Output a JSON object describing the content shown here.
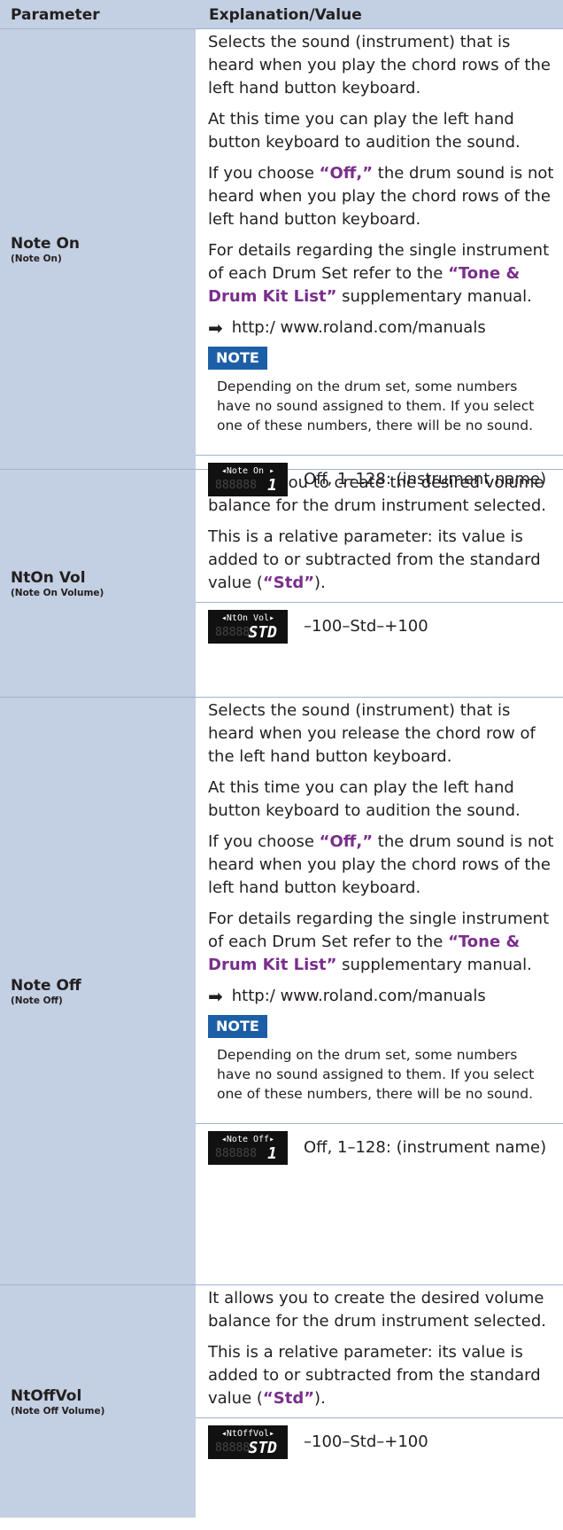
{
  "header": {
    "col1": "Parameter",
    "col2": "Explanation/Value"
  },
  "rows": [
    {
      "name": "Note On",
      "sub": "(Note On)",
      "p1": "Selects the sound (instrument) that is heard when you play the chord rows of the left hand button keyboard.",
      "p2": "At this time you can play the left hand button keyboard to audition the sound.",
      "p3a": "If you choose ",
      "p3q": "“Off,”",
      "p3b": " the drum sound is not heard when you play the chord rows of the left hand button keyboard.",
      "p4a": "For details regarding the single instrument of each Drum Set refer to the ",
      "p4q": "“Tone & Drum Kit List”",
      "p4b": " supplementary manual.",
      "link": "http:/ www.roland.com/manuals",
      "note_label": "NOTE",
      "note": "Depending on the drum set, some numbers have no sound assigned to them. If you select one of these numbers, there will be no sound.",
      "lcd_top": "◂Note On ▸",
      "lcd_val": "1",
      "value": "Off, 1–128: (instrument name)"
    },
    {
      "name": "NtOn Vol",
      "sub": "(Note On Volume)",
      "p1": "It allows you to create the desired volume balance for the drum instrument selected.",
      "p2a": "This is a relative parameter: its value is added to or subtracted from the standard value (",
      "p2q": "“Std”",
      "p2b": ").",
      "lcd_top": "◂NtOn Vol▸",
      "lcd_val": "STD",
      "value": "–100–Std–+100"
    },
    {
      "name": "Note Off",
      "sub": "(Note Off)",
      "p1": "Selects the sound (instrument) that is heard when you release the chord row of the left hand button keyboard.",
      "p2": "At this time you can play the left hand button keyboard to audition the sound.",
      "p3a": "If you choose ",
      "p3q": "“Off,”",
      "p3b": " the drum sound is not heard when you play the chord rows of the left hand button keyboard.",
      "p4a": "For details regarding the single instrument of each Drum Set refer to the ",
      "p4q": "“Tone & Drum Kit List”",
      "p4b": " supplementary manual.",
      "link": "http:/ www.roland.com/manuals",
      "note_label": "NOTE",
      "note": "Depending on the drum set, some numbers have no sound assigned to them. If you select one of these numbers, there will be no sound.",
      "lcd_top": "◂Note Off▸",
      "lcd_val": "1",
      "value": "Off, 1–128: (instrument name)"
    },
    {
      "name": "NtOffVol",
      "sub": "(Note Off Volume)",
      "p1": "It allows you to create the desired volume balance for the drum instrument selected.",
      "p2a": "This is a relative parameter: its value is added to or subtracted from the standard value (",
      "p2q": "“Std”",
      "p2b": ").",
      "lcd_top": "◂NtOffVol▸",
      "lcd_val": "STD",
      "value": "–100–Std–+100"
    }
  ]
}
